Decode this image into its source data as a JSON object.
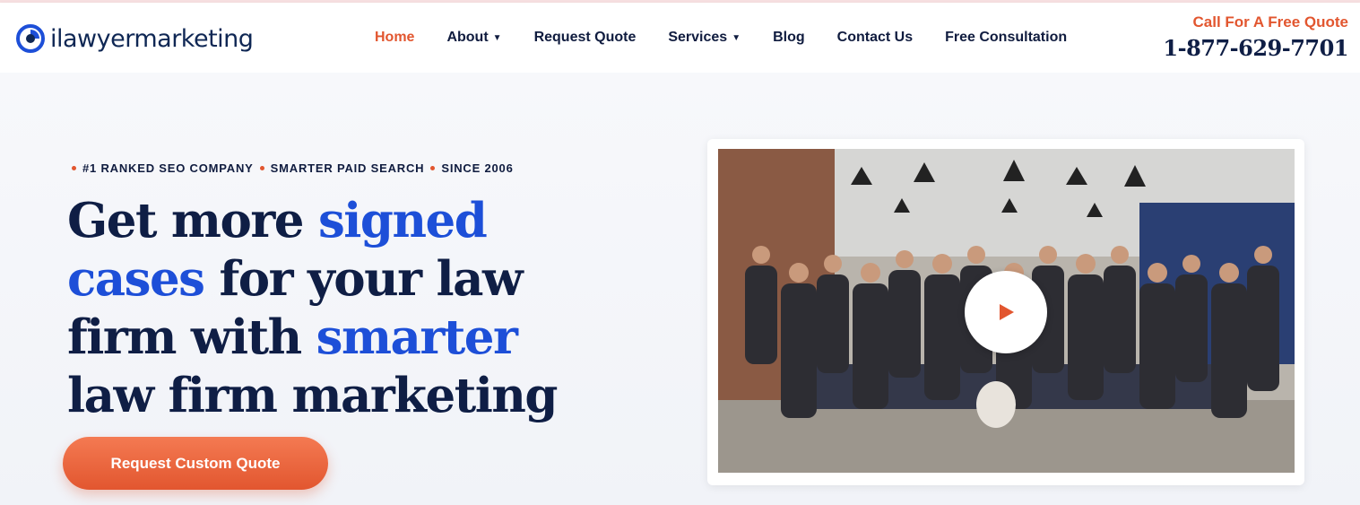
{
  "header": {
    "logo_text": "ilawyermarketing",
    "nav": [
      {
        "label": "Home",
        "active": true
      },
      {
        "label": "About",
        "dropdown": true
      },
      {
        "label": "Request Quote"
      },
      {
        "label": "Services",
        "dropdown": true
      },
      {
        "label": "Blog"
      },
      {
        "label": "Contact Us"
      },
      {
        "label": "Free Consultation"
      }
    ],
    "cta_label": "Call For A Free Quote",
    "phone": "1-877-629-7701"
  },
  "hero": {
    "tagline": [
      "#1 RANKED SEO COMPANY",
      "SMARTER PAID SEARCH",
      "SINCE 2006"
    ],
    "headline": {
      "part1": "Get more ",
      "hl1": "signed",
      "part2": "cases",
      "part3": " for your law",
      "part4": "firm with ",
      "hl3": "smarter",
      "part5": "law firm marketing"
    },
    "button": "Request Custom Quote"
  },
  "video": {
    "icon": "play-icon",
    "description_icon": "team-photo"
  },
  "colors": {
    "accent": "#e2562f",
    "navy": "#0f1e45",
    "highlight_blue": "#1d4fd8"
  }
}
